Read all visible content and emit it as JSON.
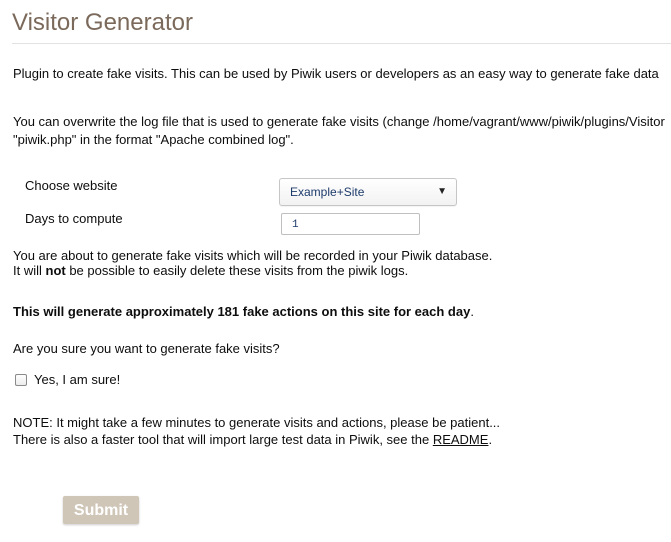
{
  "page": {
    "title": "Visitor Generator",
    "description": "Plugin to create fake visits. This can be used by Piwik users or developers as an easy way to generate fake data",
    "overwrite_line1": "You can overwrite the log file that is used to generate fake visits (change /home/vagrant/www/piwik/plugins/Visitor",
    "overwrite_line2": "\"piwik.php\" in the format \"Apache combined log\"."
  },
  "form": {
    "website_label": "Choose website",
    "website_value": "Example+Site",
    "days_label": "Days to compute",
    "days_value": "1"
  },
  "warning": {
    "line1": "You are about to generate fake visits which will be recorded in your Piwik database.",
    "line2_prefix": "It will ",
    "line2_emphasis": "not",
    "line2_suffix": " be possible to easily delete these visits from the piwik logs."
  },
  "estimate": {
    "bold_text": "This will generate approximately 181 fake actions on this site for each day",
    "suffix": "."
  },
  "confirm": {
    "question": "Are you sure you want to generate fake visits?",
    "checkbox_label": "Yes, I am sure!"
  },
  "note": {
    "line1": "NOTE: It might take a few minutes to generate visits and actions, please be patient...",
    "line2_prefix": "There is also a faster tool that will import large test data in Piwik, see the ",
    "readme_link": "README",
    "line2_suffix": "."
  },
  "submit_label": "Submit",
  "icons": {
    "dropdown_arrow": "▼"
  }
}
